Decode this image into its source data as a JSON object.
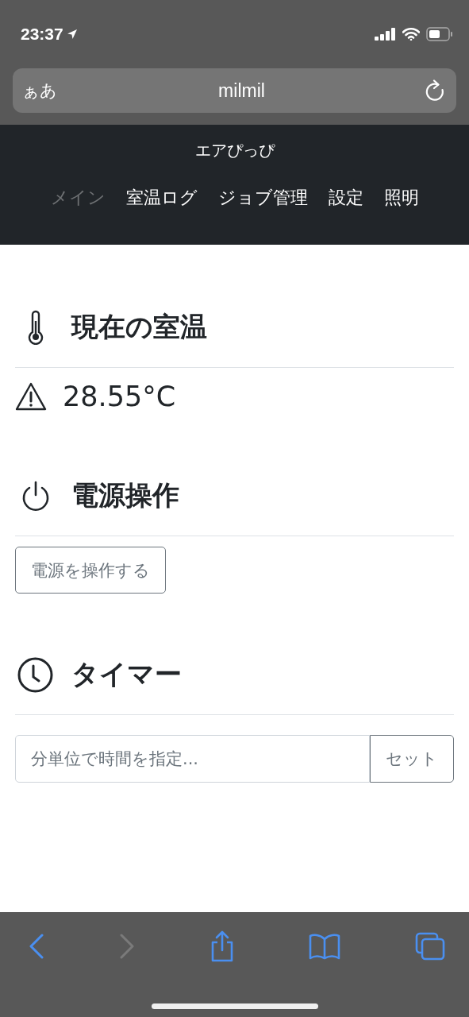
{
  "status_bar": {
    "time": "23:37"
  },
  "address_bar": {
    "text_size_button": "ぁあ",
    "domain": "milmil"
  },
  "navbar": {
    "brand": "エアぴっぴ",
    "links": [
      {
        "label": "メイン",
        "selected": true
      },
      {
        "label": "室温ログ",
        "selected": false
      },
      {
        "label": "ジョブ管理",
        "selected": false
      },
      {
        "label": "設定",
        "selected": false
      },
      {
        "label": "照明",
        "selected": false
      }
    ]
  },
  "sections": [
    {
      "kind": "temperature",
      "heading": "現在の室温",
      "reading": "28.55°C",
      "warning": true
    },
    {
      "kind": "power",
      "heading": "電源操作",
      "button": "電源を操作する"
    },
    {
      "kind": "timer",
      "heading": "タイマー",
      "placeholder": "分単位で時間を指定...",
      "button": "セット"
    }
  ],
  "toolbar": {
    "back_disabled": false,
    "forward_disabled": true
  }
}
